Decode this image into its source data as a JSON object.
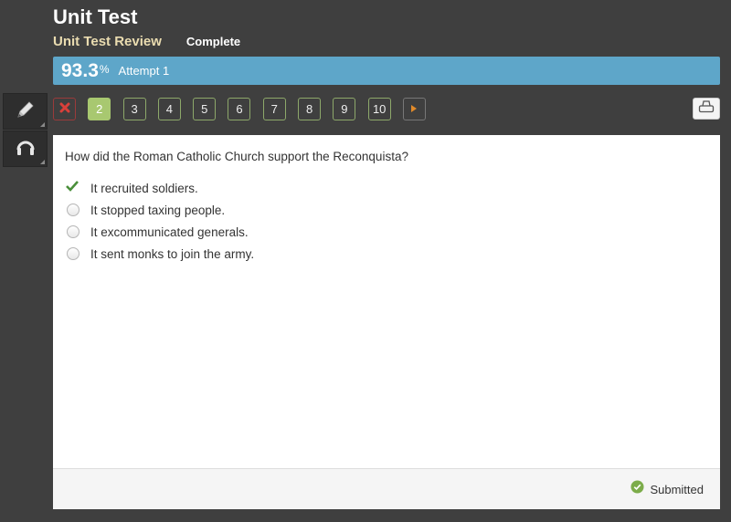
{
  "header": {
    "title": "Unit Test",
    "subtitle": "Unit Test Review",
    "status": "Complete"
  },
  "score_bar": {
    "score": "93.3",
    "percent_sign": "%",
    "attempt": "Attempt 1"
  },
  "tools": [
    {
      "name": "pencil-icon"
    },
    {
      "name": "headphones-icon"
    }
  ],
  "nav": {
    "items": [
      {
        "label": "",
        "state": "incorrect",
        "icon": "x-icon"
      },
      {
        "label": "2",
        "state": "current"
      },
      {
        "label": "3",
        "state": "answered"
      },
      {
        "label": "4",
        "state": "answered"
      },
      {
        "label": "5",
        "state": "answered"
      },
      {
        "label": "6",
        "state": "answered"
      },
      {
        "label": "7",
        "state": "answered"
      },
      {
        "label": "8",
        "state": "answered"
      },
      {
        "label": "9",
        "state": "answered"
      },
      {
        "label": "10",
        "state": "answered"
      }
    ],
    "next_icon": "triangle-right-icon",
    "print_icon": "printer-icon"
  },
  "question": {
    "text": "How did the Roman Catholic Church support the Reconquista?",
    "answers": [
      {
        "text": "It recruited soldiers.",
        "selected": true,
        "correct": true
      },
      {
        "text": "It stopped taxing people.",
        "selected": false
      },
      {
        "text": "It excommunicated generals.",
        "selected": false
      },
      {
        "text": "It sent monks to join the army.",
        "selected": false
      }
    ]
  },
  "footer": {
    "status": "Submitted"
  },
  "colors": {
    "background": "#3f3f3f",
    "score_bar": "#5ea6c9",
    "subtitle": "#eadcb0",
    "current_question": "#a8c870",
    "correct": "#4a8f3a",
    "incorrect": "#c0392b",
    "next_arrow": "#e08a2a"
  }
}
